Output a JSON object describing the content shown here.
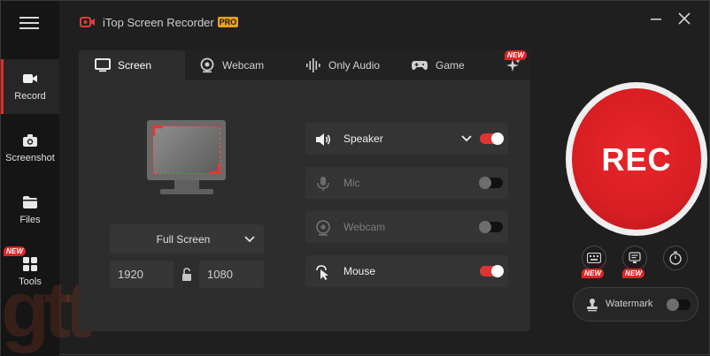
{
  "app": {
    "title": "iTop Screen Recorder",
    "badge": "PRO",
    "accent": "#e32b2b"
  },
  "sidebar": {
    "items": [
      {
        "label": "Record",
        "icon": "video-camera-icon",
        "active": true
      },
      {
        "label": "Screenshot",
        "icon": "camera-icon",
        "active": false
      },
      {
        "label": "Files",
        "icon": "folder-icon",
        "active": false
      },
      {
        "label": "Tools",
        "icon": "grid-icon",
        "active": false,
        "badge": "NEW"
      }
    ]
  },
  "tabs": [
    {
      "label": "Screen",
      "icon": "monitor-icon",
      "active": true
    },
    {
      "label": "Webcam",
      "icon": "webcam-icon",
      "active": false
    },
    {
      "label": "Only Audio",
      "icon": "waveform-icon",
      "active": false
    },
    {
      "label": "Game",
      "icon": "gamepad-icon",
      "active": false
    },
    {
      "label": "",
      "icon": "sparkle-icon",
      "active": false,
      "badge": "NEW"
    }
  ],
  "screen": {
    "mode": "Full Screen",
    "width": "1920",
    "height": "1080"
  },
  "sources": [
    {
      "label": "Speaker",
      "icon": "speaker-icon",
      "on": true,
      "has_dropdown": true
    },
    {
      "label": "Mic",
      "icon": "mic-icon",
      "on": false
    },
    {
      "label": "Webcam",
      "icon": "webcam-icon",
      "on": false
    },
    {
      "label": "Mouse",
      "icon": "cursor-click-icon",
      "on": true
    }
  ],
  "rec": {
    "label": "REC"
  },
  "tools": [
    {
      "icon": "keyboard-icon",
      "badge": "NEW"
    },
    {
      "icon": "note-icon",
      "badge": "NEW"
    },
    {
      "icon": "timer-icon"
    }
  ],
  "watermark": {
    "label": "Watermark",
    "on": false
  },
  "brand_mark": "gtt"
}
